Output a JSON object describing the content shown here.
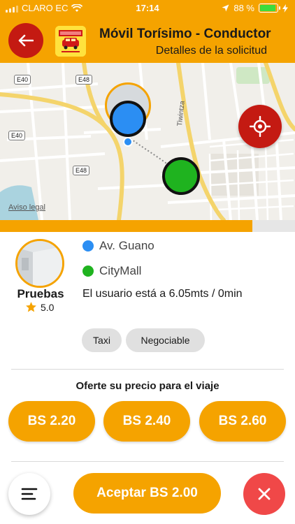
{
  "status_bar": {
    "carrier": "CLARO EC",
    "time": "17:14",
    "battery": "88 %"
  },
  "header": {
    "title": "Móvil Torísimo - Conductor",
    "subtitle": "Detalles de la solicitud"
  },
  "map": {
    "road_labels": [
      "E40",
      "E48",
      "E40",
      "E48",
      "Tiwintza"
    ],
    "legal": "Aviso legal",
    "origin_color": "#2b8ef3",
    "destination_color": "#1fb31f"
  },
  "progress": {
    "fraction": 0.855
  },
  "rider": {
    "name": "Pruebas",
    "rating": "5.0"
  },
  "trip": {
    "origin": "Av. Guano",
    "destination": "CityMall",
    "distance_text": "El usuario está a 6.05mts / 0min"
  },
  "tags": [
    "Taxi",
    "Negociable"
  ],
  "offer": {
    "title": "Oferte su precio para el viaje",
    "prices": [
      "BS 2.20",
      "BS 2.40",
      "BS 2.60"
    ]
  },
  "actions": {
    "accept_label": "Aceptar BS 2.00"
  },
  "colors": {
    "accent": "#f5a300",
    "danger": "#c41a12",
    "cancel": "#f04848"
  },
  "icons": [
    "back-arrow-icon",
    "app-logo-icon",
    "locate-crosshair-icon",
    "star-icon",
    "menu-icon",
    "close-icon",
    "wifi-icon",
    "location-arrow-icon",
    "battery-icon"
  ]
}
